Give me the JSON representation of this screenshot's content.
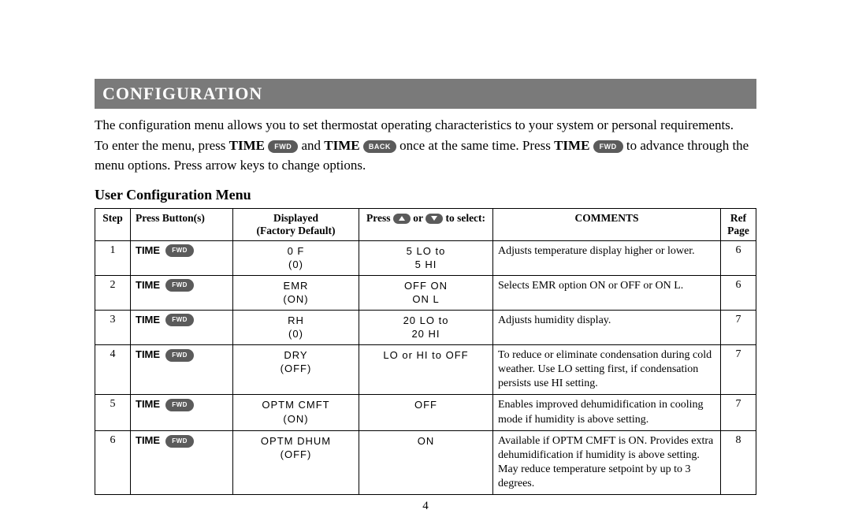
{
  "heading": "CONFIGURATION",
  "intro": {
    "line1": "The configuration menu allows you to set thermostat operating characteristics to your system or personal requirements.",
    "p2_a": "To enter the menu, press ",
    "p2_time1": "TIME",
    "p2_fwd": "FWD",
    "p2_b": " and ",
    "p2_time2": "TIME",
    "p2_back": "BACK",
    "p2_c": " once at the same time. Press ",
    "p2_time3": "TIME",
    "p2_fwd2": "FWD",
    "p2_d": " to advance through the menu options. Press arrow keys to change options."
  },
  "subheading": "User Configuration Menu",
  "table": {
    "headers": {
      "step": "Step",
      "buttons": "Press Button(s)",
      "displayed_l1": "Displayed",
      "displayed_l2": "(Factory Default)",
      "select_a": "Press ",
      "select_b": " or ",
      "select_c": " to select:",
      "comments": "COMMENTS",
      "ref_l1": "Ref",
      "ref_l2": "Page"
    },
    "btn_time": "TIME",
    "btn_fwd": "FWD",
    "rows": [
      {
        "step": "1",
        "displayed_l1": "0 F",
        "displayed_l2": "(0)",
        "select_l1": "5 LO to",
        "select_l2": "5 HI",
        "comments": "Adjusts temperature display higher or lower.",
        "ref": "6"
      },
      {
        "step": "2",
        "displayed_l1": "EMR",
        "displayed_l2": "(ON)",
        "select_l1": "OFF ON",
        "select_l2": "ON L",
        "comments": "Selects EMR option ON or OFF or ON L.",
        "ref": "6"
      },
      {
        "step": "3",
        "displayed_l1": "RH",
        "displayed_l2": "(0)",
        "select_l1": "20 LO to",
        "select_l2": "20 HI",
        "comments": "Adjusts humidity display.",
        "ref": "7"
      },
      {
        "step": "4",
        "displayed_l1": "DRY",
        "displayed_l2": "(OFF)",
        "select_l1": "LO or HI to OFF",
        "select_l2": "",
        "comments": "To reduce or eliminate condensation during cold weather. Use LO setting first, if condensation persists use HI setting.",
        "ref": "7"
      },
      {
        "step": "5",
        "displayed_l1": "OPTM CMFT",
        "displayed_l2": "(ON)",
        "select_l1": "OFF",
        "select_l2": "",
        "comments": "Enables improved dehumidification in cooling mode if humidity is above setting.",
        "ref": "7"
      },
      {
        "step": "6",
        "displayed_l1": "OPTM DHUM",
        "displayed_l2": "(OFF)",
        "select_l1": "ON",
        "select_l2": "",
        "comments": "Available if OPTM CMFT is ON. Provides extra dehumidification if humidity is above setting. May reduce temperature setpoint by up to 3 degrees.",
        "ref": "8"
      }
    ]
  },
  "page_number": "4"
}
